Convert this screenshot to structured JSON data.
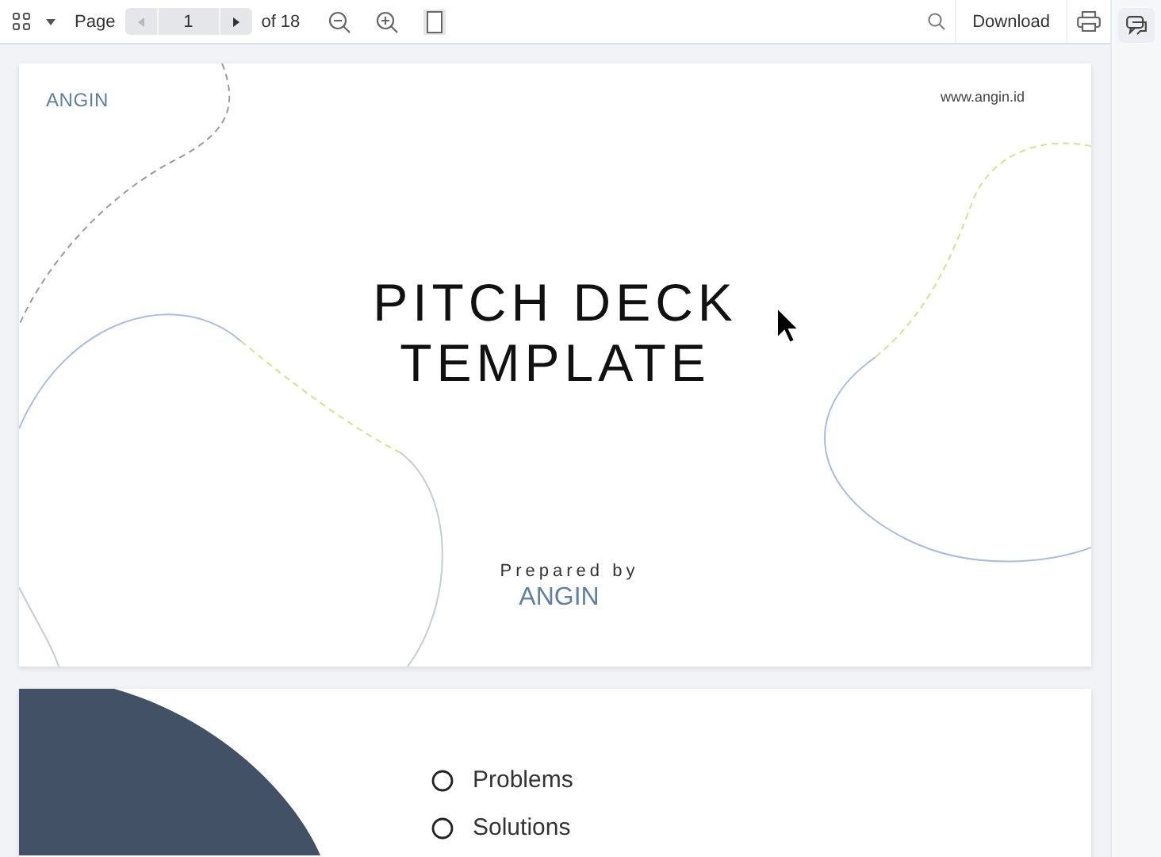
{
  "toolbar": {
    "page_label": "Page",
    "page_number": "1",
    "page_total": "of 18",
    "download": "Download"
  },
  "slides": [
    {
      "kind": "title",
      "logo": "ANGIN",
      "url": "www.angin.id",
      "title_lines": [
        "PITCH DECK",
        "TEMPLATE"
      ],
      "prepared_by": "Prepared by",
      "footer_logo": "ANGIN"
    },
    {
      "kind": "agenda",
      "items": [
        "Problems",
        "Solutions"
      ]
    }
  ]
}
